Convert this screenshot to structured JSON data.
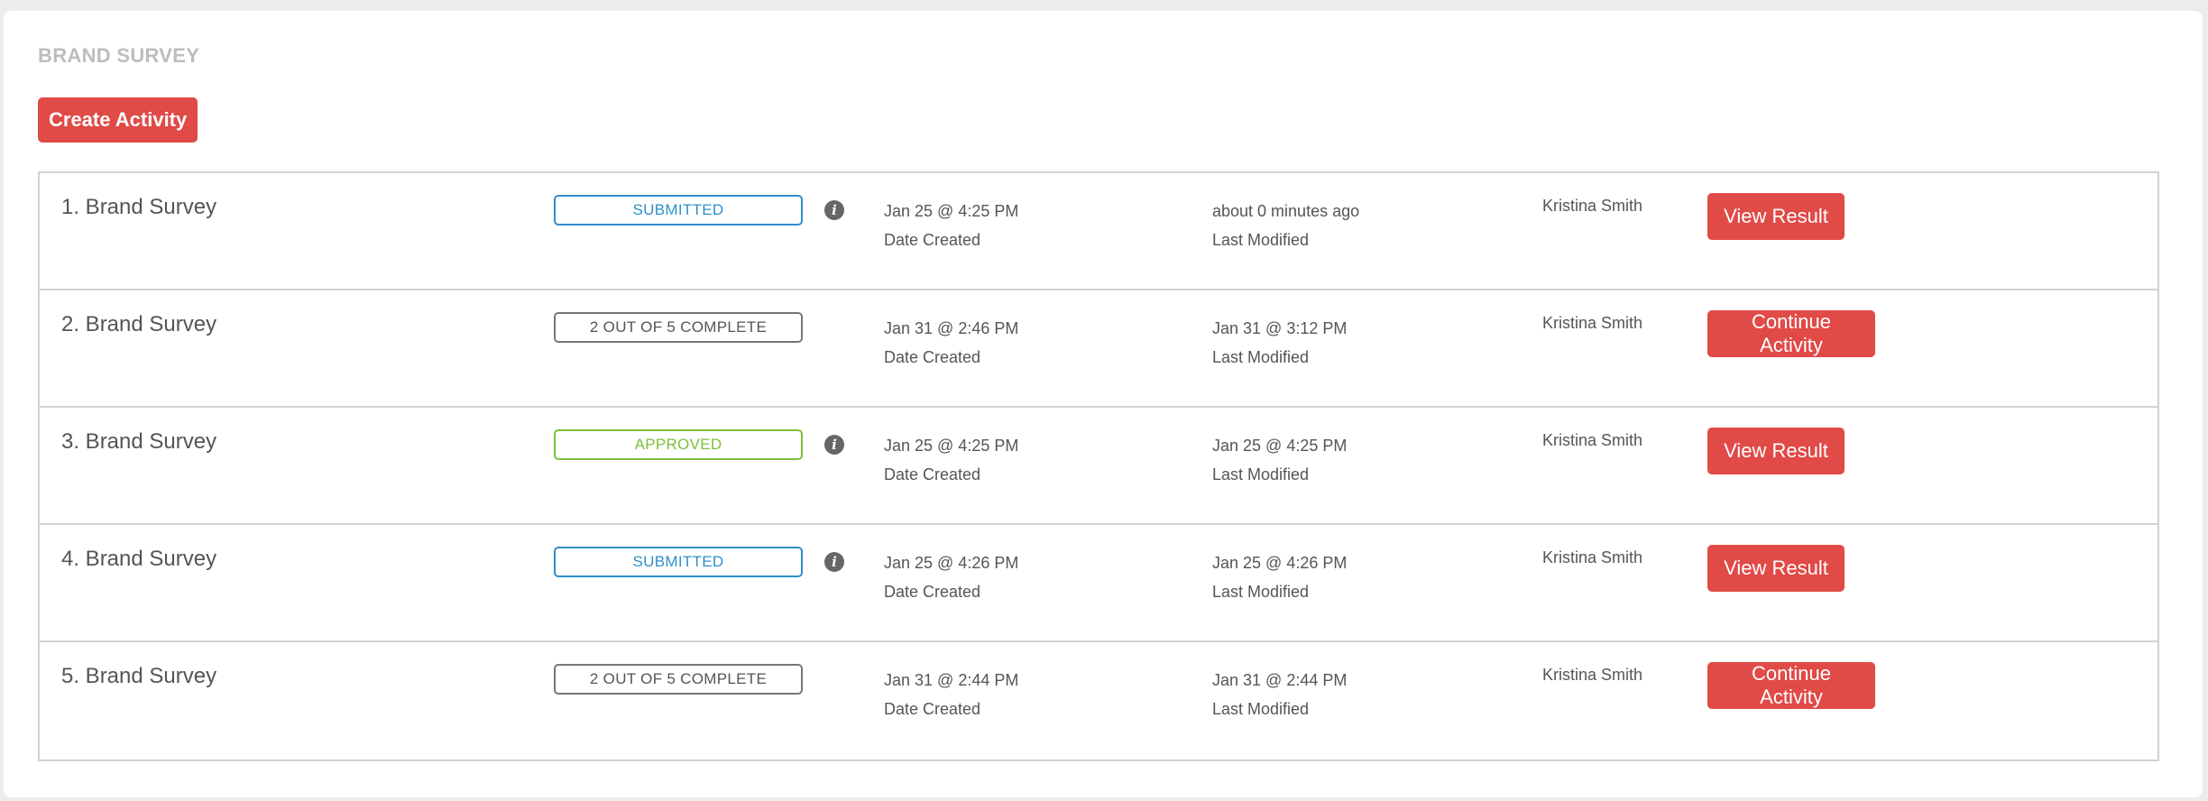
{
  "header": {
    "section_title": "BRAND SURVEY",
    "create_button": "Create Activity"
  },
  "colors": {
    "accent_red": "#e04a47",
    "status_submitted": "#2f8fc9",
    "status_approved": "#7cbf3a",
    "status_progress": "#777777"
  },
  "rows": [
    {
      "title": "1. Brand Survey",
      "status": "SUBMITTED",
      "status_type": "submitted",
      "info_icon": true,
      "date_created": "Jan 25 @ 4:25 PM",
      "date_created_label": "Date Created",
      "last_modified": "about 0 minutes ago",
      "last_modified_label": "Last Modified",
      "owner": "Kristina Smith",
      "action": "View Result"
    },
    {
      "title": "2. Brand Survey",
      "status": "2 OUT OF 5 COMPLETE",
      "status_type": "progress",
      "info_icon": false,
      "date_created": "Jan 31 @ 2:46 PM",
      "date_created_label": "Date Created",
      "last_modified": "Jan 31 @ 3:12 PM",
      "last_modified_label": "Last Modified",
      "owner": "Kristina Smith",
      "action": "Continue Activity"
    },
    {
      "title": "3. Brand Survey",
      "status": "APPROVED",
      "status_type": "approved",
      "info_icon": true,
      "date_created": "Jan 25 @ 4:25 PM",
      "date_created_label": "Date Created",
      "last_modified": "Jan 25 @ 4:25 PM",
      "last_modified_label": "Last Modified",
      "owner": "Kristina Smith",
      "action": "View Result"
    },
    {
      "title": "4. Brand Survey",
      "status": "SUBMITTED",
      "status_type": "submitted",
      "info_icon": true,
      "date_created": "Jan 25 @ 4:26 PM",
      "date_created_label": "Date Created",
      "last_modified": "Jan 25 @ 4:26 PM",
      "last_modified_label": "Last Modified",
      "owner": "Kristina Smith",
      "action": "View Result"
    },
    {
      "title": "5. Brand Survey",
      "status": "2 OUT OF 5 COMPLETE",
      "status_type": "progress",
      "info_icon": false,
      "date_created": "Jan 31 @ 2:44 PM",
      "date_created_label": "Date Created",
      "last_modified": "Jan 31 @ 2:44 PM",
      "last_modified_label": "Last Modified",
      "owner": "Kristina Smith",
      "action": "Continue Activity"
    }
  ]
}
